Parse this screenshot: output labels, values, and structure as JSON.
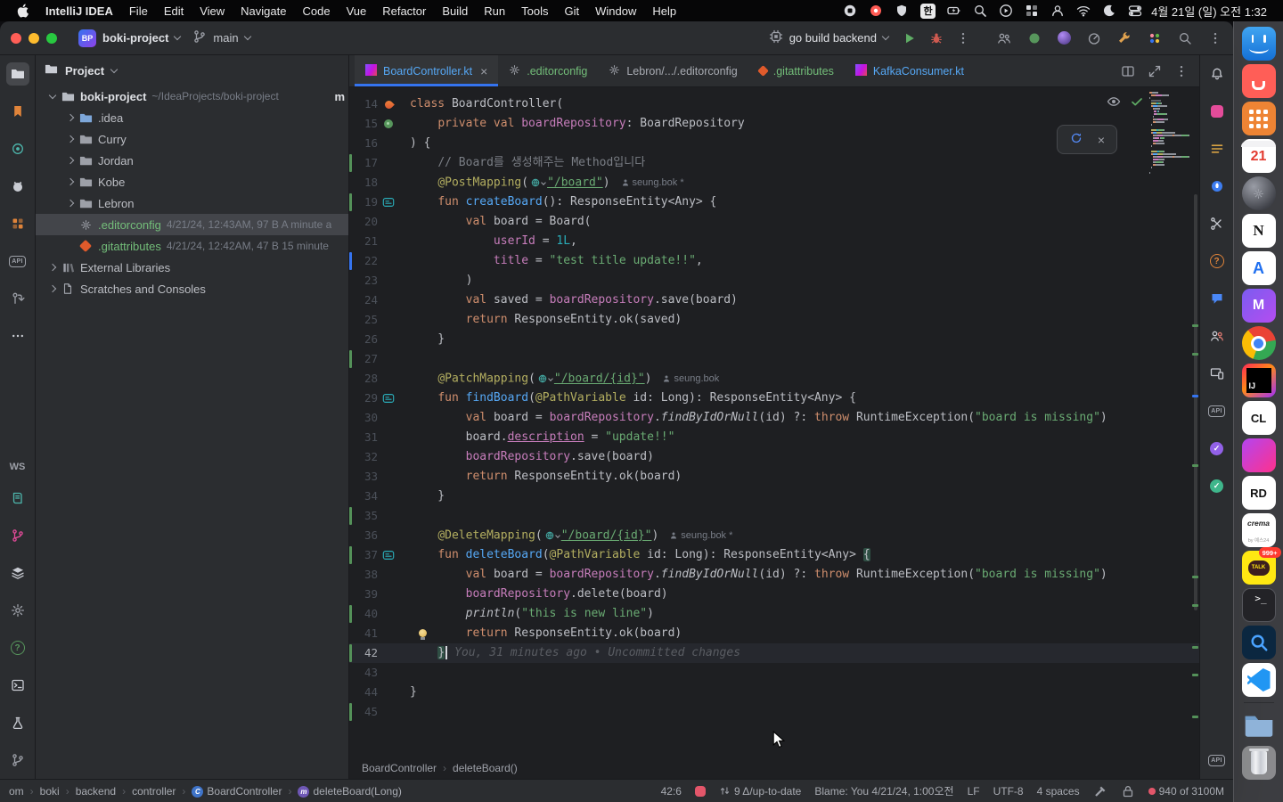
{
  "menubar": {
    "items": [
      "IntelliJ IDEA",
      "File",
      "Edit",
      "View",
      "Navigate",
      "Code",
      "Vue",
      "Refactor",
      "Build",
      "Run",
      "Tools",
      "Git",
      "Window",
      "Help"
    ],
    "status_icons": [
      "stop",
      "record",
      "shield",
      "ime",
      "battery",
      "spotlight",
      "play",
      "tiles",
      "user",
      "wifi",
      "moon",
      "control-center"
    ],
    "ime_label": "한",
    "clock": "4월 21일 (일) 오전 1:32"
  },
  "titlebar": {
    "project_badge": "BP",
    "project_name": "boki-project",
    "branch_name": "main",
    "run_config": "go build backend",
    "right_icons": [
      "collaborators",
      "code-with-me",
      "ai-assistant",
      "profiler",
      "toolbox",
      "plugins",
      "search",
      "more-vertical"
    ]
  },
  "left_stripe": {
    "top": [
      "project",
      "bookmarks",
      "spring",
      "github",
      "services",
      "api",
      "pull-requests",
      "more"
    ],
    "ws_label": "WS",
    "bottom": [
      "docs",
      "fork",
      "layers",
      "settings",
      "help",
      "terminal",
      "flask",
      "git"
    ]
  },
  "right_stripe": {
    "top": [
      "notifications",
      "pin",
      "list",
      "rocket",
      "scissors",
      "question",
      "chat",
      "users",
      "devices",
      "api",
      "approval",
      "check"
    ],
    "bottom": [
      "api"
    ]
  },
  "project_panel": {
    "header": "Project",
    "tree": [
      {
        "indent": 0,
        "chev": "open",
        "icon": "project",
        "label": "boki-project",
        "meta": "~/IdeaProjects/boki-project",
        "right": "m",
        "bold": true
      },
      {
        "indent": 1,
        "chev": "closed",
        "icon": "folder-idea",
        "label": ".idea"
      },
      {
        "indent": 1,
        "chev": "closed",
        "icon": "folder",
        "label": "Curry"
      },
      {
        "indent": 1,
        "chev": "closed",
        "icon": "folder",
        "label": "Jordan"
      },
      {
        "indent": 1,
        "chev": "closed",
        "icon": "folder",
        "label": "Kobe"
      },
      {
        "indent": 1,
        "chev": "closed",
        "icon": "folder",
        "label": "Lebron"
      },
      {
        "indent": 1,
        "chev": "none",
        "icon": "editorconfig",
        "label": ".editorconfig",
        "meta": "4/21/24, 12:43AM, 97 B A minute a",
        "vcs": "added",
        "selected": true
      },
      {
        "indent": 1,
        "chev": "none",
        "icon": "git-file",
        "label": ".gitattributes",
        "meta": "4/21/24, 12:42AM, 47 B 15 minute",
        "vcs": "added"
      },
      {
        "indent": 0,
        "chev": "closed",
        "icon": "library",
        "label": "External Libraries"
      },
      {
        "indent": 0,
        "chev": "closed",
        "icon": "scratch",
        "label": "Scratches and Consoles"
      }
    ]
  },
  "tabs": {
    "items": [
      {
        "label": "BoardController.kt",
        "icon": "kotlin",
        "vcs": "modified",
        "active": true,
        "close": true
      },
      {
        "label": ".editorconfig",
        "icon": "editorconfig",
        "vcs": "added"
      },
      {
        "label": "Lebron/.../.editorconfig",
        "icon": "editorconfig",
        "vcs": "none"
      },
      {
        "label": ".gitattributes",
        "icon": "git-file",
        "vcs": "added"
      },
      {
        "label": "KafkaConsumer.kt",
        "icon": "kotlin",
        "vcs": "modified"
      }
    ],
    "actions": [
      "split",
      "maximize",
      "more-vertical"
    ]
  },
  "editor": {
    "breadcrumbs": [
      "BoardController",
      "deleteBoard()"
    ],
    "lines": [
      {
        "n": 14,
        "g": "spring",
        "t": [
          [
            "k",
            "class "
          ],
          [
            "d",
            "BoardController("
          ]
        ]
      },
      {
        "n": 15,
        "g": "bean",
        "t": [
          [
            "d",
            "    "
          ],
          [
            "k",
            "private val "
          ],
          [
            "p",
            "boardRepository"
          ],
          [
            "d",
            ": BoardRepository"
          ]
        ]
      },
      {
        "n": 16,
        "t": [
          [
            "d",
            ") {"
          ]
        ]
      },
      {
        "n": 17,
        "ch": "a",
        "t": [
          [
            "d",
            "    "
          ],
          [
            "c",
            "// Board를 생성해주는 Method입니다"
          ]
        ]
      },
      {
        "n": 18,
        "t": [
          [
            "d",
            "    "
          ],
          [
            "a",
            "@PostMapping"
          ],
          [
            "d",
            "("
          ],
          [
            "G",
            ""
          ],
          [
            "su",
            "\"/board\""
          ],
          [
            "d",
            ")"
          ]
        ],
        "inlay": "seung.bok *"
      },
      {
        "n": 19,
        "g": "api",
        "ch": "a",
        "t": [
          [
            "d",
            "    "
          ],
          [
            "k",
            "fun "
          ],
          [
            "f",
            "createBoard"
          ],
          [
            "d",
            "(): ResponseEntity<Any> {"
          ]
        ]
      },
      {
        "n": 20,
        "t": [
          [
            "d",
            "        "
          ],
          [
            "k",
            "val "
          ],
          [
            "d",
            "board = Board("
          ]
        ]
      },
      {
        "n": 21,
        "t": [
          [
            "d",
            "            "
          ],
          [
            "p",
            "userId"
          ],
          [
            "d",
            " = "
          ],
          [
            "n",
            "1L"
          ],
          [
            "d",
            ","
          ]
        ]
      },
      {
        "n": 22,
        "ch": "m",
        "t": [
          [
            "d",
            "            "
          ],
          [
            "p",
            "title"
          ],
          [
            "d",
            " = "
          ],
          [
            "s",
            "\"test title update!!\""
          ],
          [
            "d",
            ","
          ]
        ]
      },
      {
        "n": 23,
        "t": [
          [
            "d",
            "        )"
          ]
        ]
      },
      {
        "n": 24,
        "t": [
          [
            "d",
            "        "
          ],
          [
            "k",
            "val "
          ],
          [
            "d",
            "saved = "
          ],
          [
            "p",
            "boardRepository"
          ],
          [
            "d",
            ".save(board)"
          ]
        ]
      },
      {
        "n": 25,
        "t": [
          [
            "d",
            "        "
          ],
          [
            "k",
            "return "
          ],
          [
            "d",
            "ResponseEntity.ok(saved)"
          ]
        ]
      },
      {
        "n": 26,
        "t": [
          [
            "d",
            "    }"
          ]
        ]
      },
      {
        "n": 27,
        "ch": "a",
        "t": []
      },
      {
        "n": 28,
        "t": [
          [
            "d",
            "    "
          ],
          [
            "a",
            "@PatchMapping"
          ],
          [
            "d",
            "("
          ],
          [
            "G",
            ""
          ],
          [
            "su",
            "\"/board/{id}\""
          ],
          [
            "d",
            ")"
          ]
        ],
        "inlay": "seung.bok"
      },
      {
        "n": 29,
        "g": "api",
        "t": [
          [
            "d",
            "    "
          ],
          [
            "k",
            "fun "
          ],
          [
            "f",
            "findBoard"
          ],
          [
            "d",
            "("
          ],
          [
            "a",
            "@PathVariable"
          ],
          [
            "d",
            " id: Long): ResponseEntity<Any> {"
          ]
        ]
      },
      {
        "n": 30,
        "t": [
          [
            "d",
            "        "
          ],
          [
            "k",
            "val "
          ],
          [
            "d",
            "board = "
          ],
          [
            "p",
            "boardRepository"
          ],
          [
            "d",
            "."
          ],
          [
            "x",
            "findByIdOrNull"
          ],
          [
            "d",
            "(id) ?: "
          ],
          [
            "k",
            "throw "
          ],
          [
            "d",
            "RuntimeException("
          ],
          [
            "s",
            "\"board is missing\""
          ],
          [
            "d",
            ")"
          ]
        ]
      },
      {
        "n": 31,
        "t": [
          [
            "d",
            "        board."
          ],
          [
            "pu",
            "description"
          ],
          [
            "d",
            " = "
          ],
          [
            "s",
            "\"update!!\""
          ]
        ]
      },
      {
        "n": 32,
        "t": [
          [
            "d",
            "        "
          ],
          [
            "p",
            "boardRepository"
          ],
          [
            "d",
            ".save(board)"
          ]
        ]
      },
      {
        "n": 33,
        "t": [
          [
            "d",
            "        "
          ],
          [
            "k",
            "return "
          ],
          [
            "d",
            "ResponseEntity.ok(board)"
          ]
        ]
      },
      {
        "n": 34,
        "t": [
          [
            "d",
            "    }"
          ]
        ]
      },
      {
        "n": 35,
        "ch": "a",
        "t": []
      },
      {
        "n": 36,
        "t": [
          [
            "d",
            "    "
          ],
          [
            "a",
            "@DeleteMapping"
          ],
          [
            "d",
            "("
          ],
          [
            "G",
            ""
          ],
          [
            "su",
            "\"/board/{id}\""
          ],
          [
            "d",
            ")"
          ]
        ],
        "inlay": "seung.bok *"
      },
      {
        "n": 37,
        "g": "api",
        "ch": "a",
        "t": [
          [
            "d",
            "    "
          ],
          [
            "k",
            "fun "
          ],
          [
            "f",
            "deleteBoard"
          ],
          [
            "d",
            "("
          ],
          [
            "a",
            "@PathVariable"
          ],
          [
            "d",
            " id: Long): ResponseEntity<Any> "
          ],
          [
            "hl",
            "{"
          ]
        ]
      },
      {
        "n": 38,
        "t": [
          [
            "d",
            "        "
          ],
          [
            "k",
            "val "
          ],
          [
            "d",
            "board = "
          ],
          [
            "p",
            "boardRepository"
          ],
          [
            "d",
            "."
          ],
          [
            "x",
            "findByIdOrNull"
          ],
          [
            "d",
            "(id) ?: "
          ],
          [
            "k",
            "throw "
          ],
          [
            "d",
            "RuntimeException("
          ],
          [
            "s",
            "\"board is missing\""
          ],
          [
            "d",
            ")"
          ]
        ]
      },
      {
        "n": 39,
        "t": [
          [
            "d",
            "        "
          ],
          [
            "p",
            "boardRepository"
          ],
          [
            "d",
            ".delete(board)"
          ]
        ]
      },
      {
        "n": 40,
        "ch": "a",
        "t": [
          [
            "d",
            "        "
          ],
          [
            "x",
            "println"
          ],
          [
            "d",
            "("
          ],
          [
            "s",
            "\"this is new line\""
          ],
          [
            "d",
            ")"
          ]
        ]
      },
      {
        "n": 41,
        "bulb": true,
        "t": [
          [
            "d",
            "        "
          ],
          [
            "k",
            "return "
          ],
          [
            "d",
            "ResponseEntity.ok(board)"
          ]
        ]
      },
      {
        "n": 42,
        "ch": "a",
        "caret": true,
        "blame": "You, 31 minutes ago • Uncommitted changes",
        "t": [
          [
            "d",
            "    "
          ],
          [
            "hl",
            "}"
          ]
        ]
      },
      {
        "n": 43,
        "t": []
      },
      {
        "n": 44,
        "t": [
          [
            "d",
            "}"
          ]
        ]
      },
      {
        "n": 45,
        "ch": "a",
        "t": []
      }
    ]
  },
  "statusbar": {
    "path": [
      {
        "label": "om"
      },
      {
        "label": "boki"
      },
      {
        "label": "backend"
      },
      {
        "label": "controller"
      },
      {
        "label": "BoardController",
        "icon": "class"
      },
      {
        "label": "deleteBoard(Long)",
        "icon": "method"
      }
    ],
    "caret_position": "42:6",
    "sync_status": "9 Δ/up-to-date",
    "blame": "Blame: You 4/21/24, 1:00오전",
    "line_separator": "LF",
    "encoding": "UTF-8",
    "indent": "4 spaces",
    "memory": "940 of 3100M"
  },
  "dock": [
    {
      "app": "finder"
    },
    {
      "app": "raycast"
    },
    {
      "app": "launchpad"
    },
    {
      "app": "calendar",
      "label": "21"
    },
    {
      "app": "settings"
    },
    {
      "app": "notion",
      "label": "N"
    },
    {
      "app": "app-a",
      "label": "A"
    },
    {
      "app": "app-m",
      "label": "M"
    },
    {
      "app": "chrome"
    },
    {
      "app": "intellij",
      "label": "IJ"
    },
    {
      "app": "clion",
      "label": "CL"
    },
    {
      "app": "datagrip"
    },
    {
      "app": "rider",
      "label": "RD"
    },
    {
      "app": "crema",
      "label": "crema",
      "sub": "by 예스24"
    },
    {
      "app": "kakaotalk",
      "label": "TALK",
      "badge": "999+"
    },
    {
      "app": "terminal",
      "label": ">_"
    },
    {
      "app": "search"
    },
    {
      "app": "vscode"
    },
    {
      "app": "downloads"
    },
    {
      "app": "trash"
    }
  ]
}
